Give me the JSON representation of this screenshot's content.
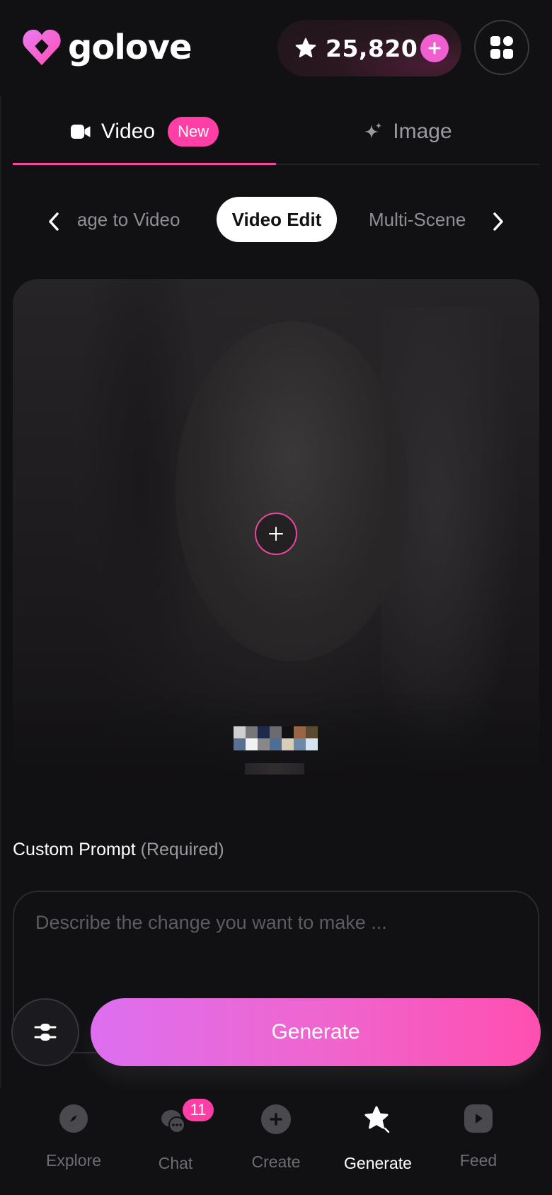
{
  "app": {
    "name": "golove",
    "brand_color": "#f05fcf"
  },
  "header": {
    "credits": "25,820",
    "credits_icon": "star-icon",
    "add_credits_icon": "plus-icon",
    "apps_icon": "grid-icon"
  },
  "tabs": [
    {
      "label": "Video",
      "icon": "video-camera-icon",
      "badge": "New",
      "active": true
    },
    {
      "label": "Image",
      "icon": "sparkle-icon",
      "active": false
    }
  ],
  "modes": {
    "items": [
      "Image to Video",
      "Video Edit",
      "Multi-Scene"
    ],
    "selected": "Video Edit",
    "prev_icon": "chevron-left-icon",
    "next_icon": "chevron-right-icon"
  },
  "preview": {
    "upload_icon": "plus-icon"
  },
  "prompt": {
    "label": "Custom Prompt",
    "required_text": "(Required)",
    "placeholder": "Describe the change you want to make ..."
  },
  "actions": {
    "settings_icon": "sliders-icon",
    "generate_label": "Generate"
  },
  "bottom_nav": [
    {
      "label": "Explore",
      "icon": "compass-icon",
      "active": false
    },
    {
      "label": "Chat",
      "icon": "chat-bubbles-icon",
      "badge": "11",
      "active": false
    },
    {
      "label": "Create",
      "icon": "plus-circle-icon",
      "active": false
    },
    {
      "label": "Generate",
      "icon": "sparkle-star-icon",
      "active": true
    },
    {
      "label": "Feed",
      "icon": "play-icon",
      "active": false
    }
  ]
}
